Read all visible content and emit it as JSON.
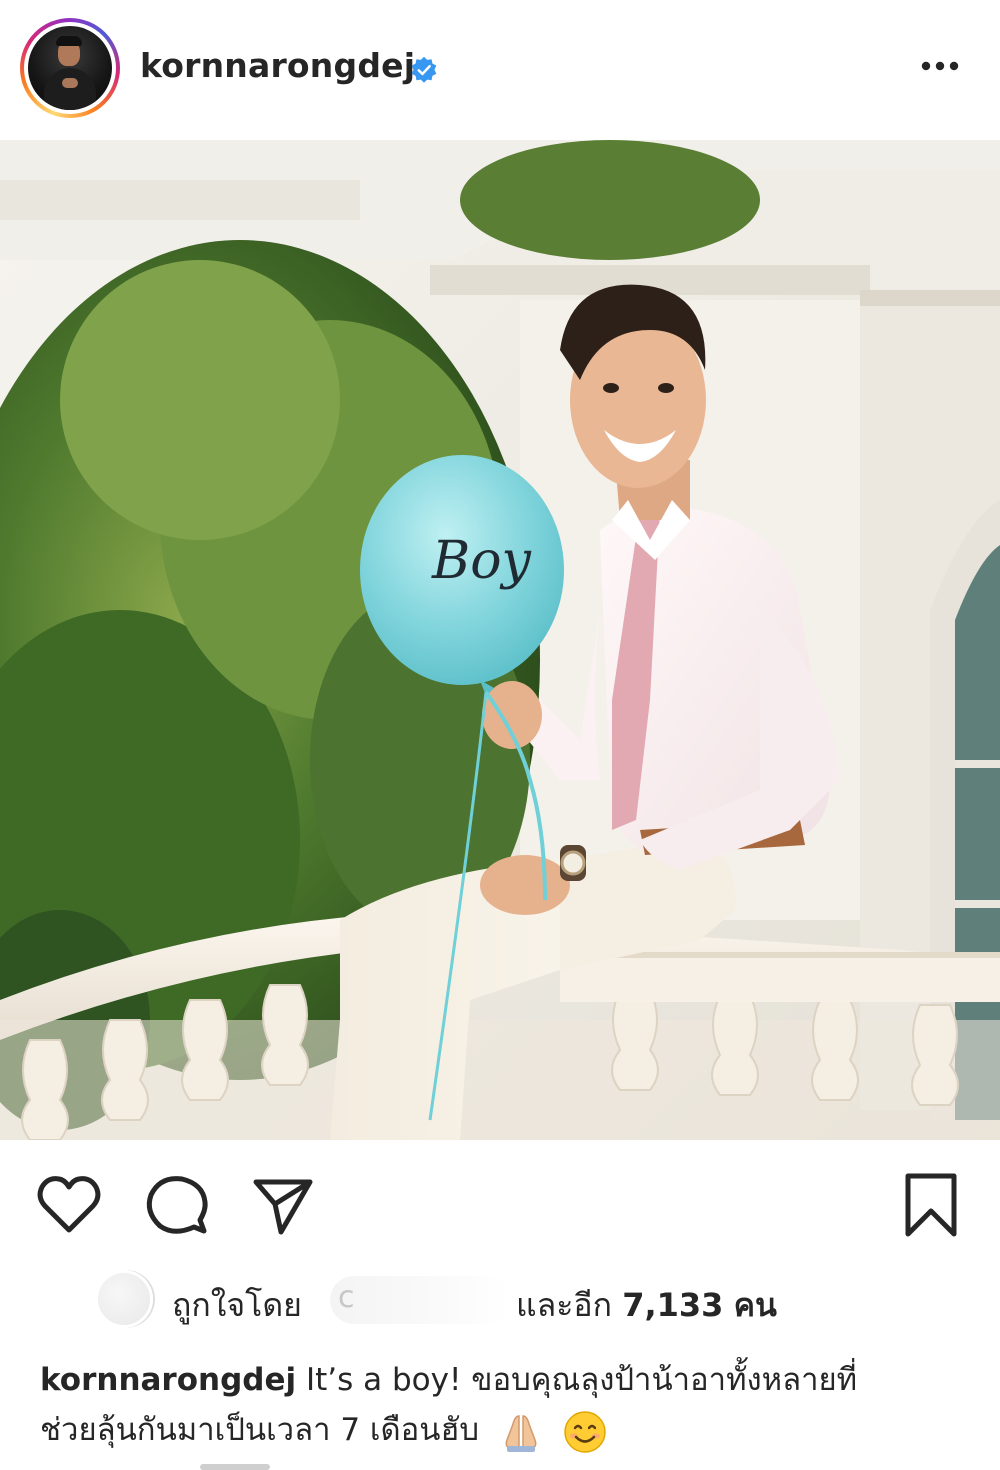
{
  "post": {
    "username": "kornnarongdej",
    "verified": true,
    "more_icon": "more-horizontal-icon"
  },
  "photo": {
    "balloon_text": "Boy",
    "balloon_color": "#7fd3dc"
  },
  "actions": {
    "like_icon": "heart-icon",
    "comment_icon": "comment-icon",
    "share_icon": "send-icon",
    "save_icon": "bookmark-icon"
  },
  "likes": {
    "liked_by_label": "ถูกใจโดย",
    "and_others_label": "และอีก",
    "count": "7,133",
    "count_unit": "คน"
  },
  "caption": {
    "username": "kornnarongdej",
    "text_line1": " It’s a boy! ขอบคุณลุงป้าน้าอาทั้งหลายที่",
    "text_line2": "ช่วยลุ้นกันมาเป็นเวลา 7 เดือนฮับ",
    "emojis": [
      "folded-hands",
      "smiling-face"
    ]
  },
  "colors": {
    "verified_blue": "#3897f0",
    "text": "#262626"
  }
}
